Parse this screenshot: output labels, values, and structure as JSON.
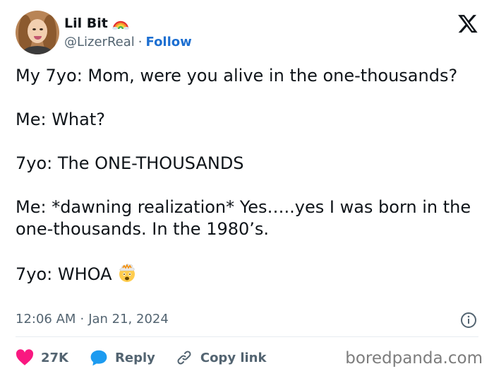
{
  "author": {
    "display_name": "Lil Bit",
    "handle": "@LizerReal",
    "separator": "·",
    "follow_label": "Follow",
    "badge_icon": "rainbow-icon"
  },
  "tweet": {
    "paragraphs": [
      "My 7yo: Mom, were you alive in the one-thousands?",
      "Me: What?",
      "7yo: The ONE-THOUSANDS",
      "Me: *dawning realization* Yes…..yes I was born in the one-thousands. In the 1980’s.",
      "7yo: WHOA"
    ],
    "emoji_icon": "exploding-head-emoji"
  },
  "meta": {
    "time": "12:06 AM",
    "separator": "·",
    "date": "Jan 21, 2024"
  },
  "actions": {
    "like_count": "27K",
    "reply_label": "Reply",
    "copy_link_label": "Copy link"
  },
  "watermark": "boredpanda.com",
  "colors": {
    "link": "#1d6fd1",
    "like_red": "#f91880",
    "reply_blue": "#1d9bf0",
    "muted": "#536471",
    "text": "#0f1419"
  }
}
